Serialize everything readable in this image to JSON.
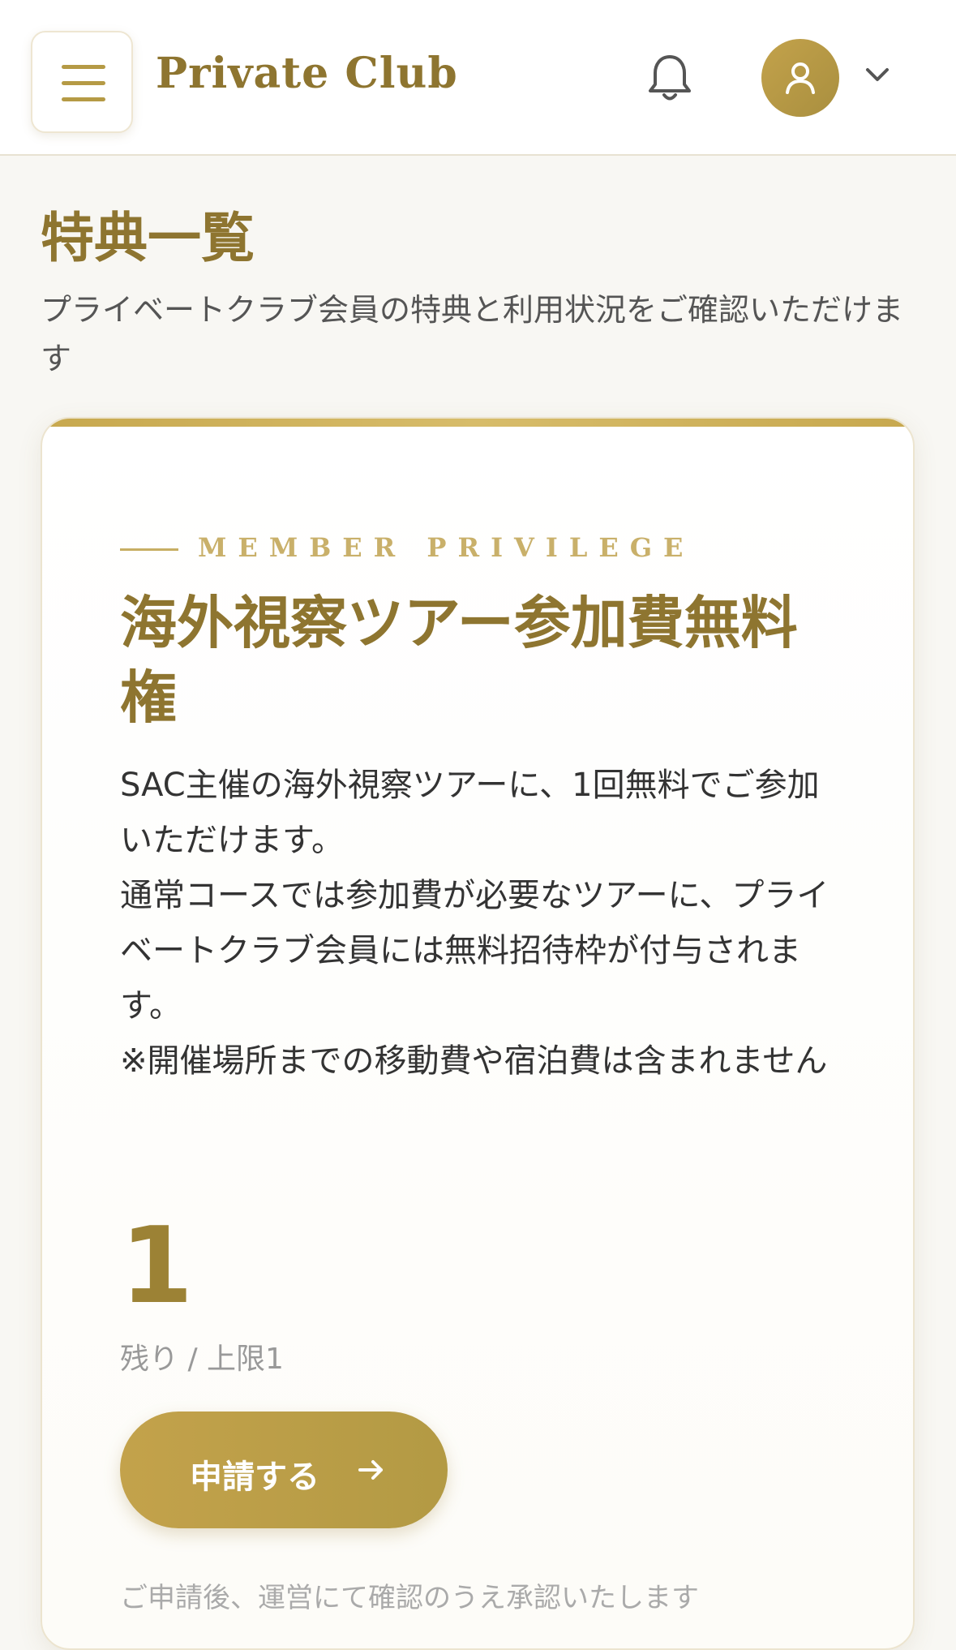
{
  "header": {
    "brand": "Private Club"
  },
  "page": {
    "title": "特典一覧",
    "subtitle": "プライベートクラブ会員の特典と利用状況をご確認いただけます"
  },
  "privilege": {
    "eyebrow": "MEMBER PRIVILEGE",
    "title": "海外視察ツアー参加費無料権",
    "description": "SAC主催の海外視察ツアーに、1回無料でご参加いただけます。\n通常コースでは参加費が必要なツアーに、プライベートクラブ会員には無料招待枠が付与されます。\n※開催場所までの移動費や宿泊費は含まれません",
    "remaining_count": "1",
    "remaining_label": "残り / 上限1",
    "apply_label": "申請する",
    "note": "ご申請後、運営にて確認のうえ承認いたします"
  },
  "colors": {
    "accent": "#b59a45",
    "title_gold": "#8e7530",
    "background": "#f8f7f3"
  },
  "icons": {
    "menu": "hamburger-icon",
    "notifications": "bell-icon",
    "user": "user-icon",
    "dropdown": "chevron-down-icon",
    "apply": "arrow-right-icon"
  }
}
